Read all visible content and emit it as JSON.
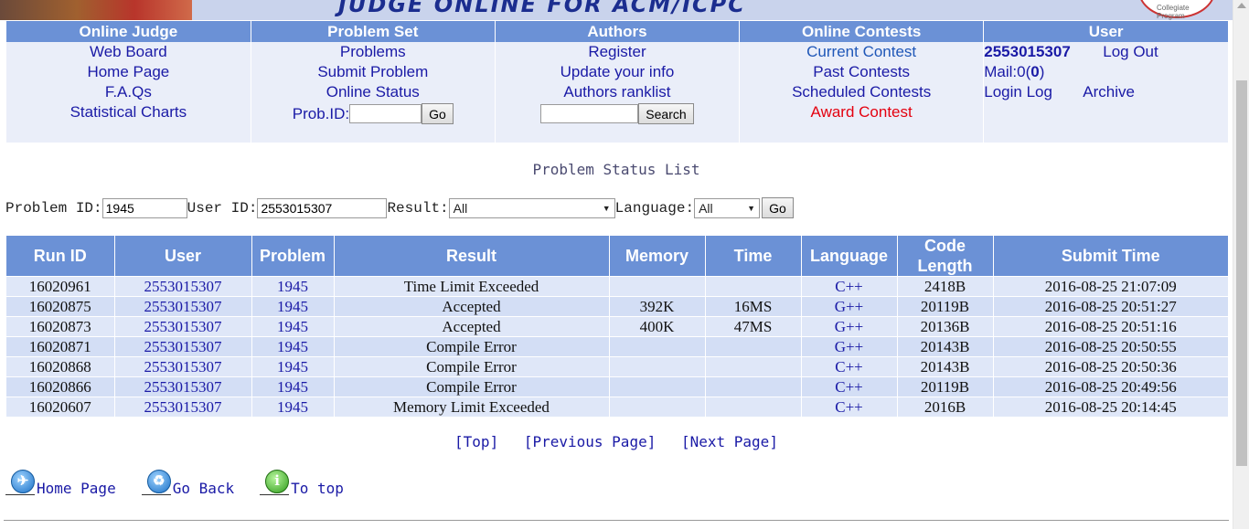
{
  "banner": {
    "title": "JUDGE ONLINE FOR ACM/ICPC",
    "logo_text": "Collegiate Program"
  },
  "nav": {
    "headers": [
      "Online Judge",
      "Problem Set",
      "Authors",
      "Online Contests",
      "User"
    ],
    "online_judge": [
      "Web Board",
      "Home Page",
      "F.A.Qs",
      "Statistical Charts"
    ],
    "problem_set": [
      "Problems",
      "Submit Problem",
      "Online Status"
    ],
    "prob_id_label": "Prob.ID:",
    "prob_id_value": "",
    "go_label": "Go",
    "authors": [
      "Register",
      "Update your info",
      "Authors ranklist"
    ],
    "author_search_value": "",
    "search_label": "Search",
    "contests": {
      "current": "Current Contest",
      "past": "Past Contests",
      "scheduled": "Scheduled Contests",
      "award": "Award Contest"
    },
    "user": {
      "id": "2553015307",
      "logout": "Log Out",
      "mail_prefix": "Mail:0(",
      "mail_count": "0",
      "mail_suffix": ")",
      "login_log": "Login Log",
      "archive": "Archive"
    }
  },
  "page_title": "Problem Status List",
  "filter": {
    "problem_label": "Problem ID:",
    "problem_value": "1945",
    "user_label": "User ID:",
    "user_value": "2553015307",
    "result_label": "Result:",
    "result_value": "All",
    "language_label": "Language:",
    "language_value": "All",
    "go_label": "Go"
  },
  "table": {
    "headers": [
      "Run ID",
      "User",
      "Problem",
      "Result",
      "Memory",
      "Time",
      "Language",
      "Code Length",
      "Submit Time"
    ],
    "rows": [
      {
        "run_id": "16020961",
        "user": "2553015307",
        "problem": "1945",
        "result": "Time Limit Exceeded",
        "result_color": "red",
        "memory": "",
        "time": "",
        "language": "C++",
        "length": "2418B",
        "submit": "2016-08-25 21:07:09"
      },
      {
        "run_id": "16020875",
        "user": "2553015307",
        "problem": "1945",
        "result": "Accepted",
        "result_color": "blue",
        "memory": "392K",
        "time": "16MS",
        "language": "G++",
        "length": "20119B",
        "submit": "2016-08-25 20:51:27"
      },
      {
        "run_id": "16020873",
        "user": "2553015307",
        "problem": "1945",
        "result": "Accepted",
        "result_color": "blue",
        "memory": "400K",
        "time": "47MS",
        "language": "G++",
        "length": "20136B",
        "submit": "2016-08-25 20:51:16"
      },
      {
        "run_id": "16020871",
        "user": "2553015307",
        "problem": "1945",
        "result": "Compile Error",
        "result_color": "green",
        "memory": "",
        "time": "",
        "language": "G++",
        "length": "20143B",
        "submit": "2016-08-25 20:50:55"
      },
      {
        "run_id": "16020868",
        "user": "2553015307",
        "problem": "1945",
        "result": "Compile Error",
        "result_color": "green",
        "memory": "",
        "time": "",
        "language": "C++",
        "length": "20143B",
        "submit": "2016-08-25 20:50:36"
      },
      {
        "run_id": "16020866",
        "user": "2553015307",
        "problem": "1945",
        "result": "Compile Error",
        "result_color": "green",
        "memory": "",
        "time": "",
        "language": "C++",
        "length": "20119B",
        "submit": "2016-08-25 20:49:56"
      },
      {
        "run_id": "16020607",
        "user": "2553015307",
        "problem": "1945",
        "result": "Memory Limit Exceeded",
        "result_color": "red",
        "memory": "",
        "time": "",
        "language": "C++",
        "length": "2016B",
        "submit": "2016-08-25 20:14:45"
      }
    ]
  },
  "pager": {
    "top": "[Top]",
    "prev": "[Previous Page]",
    "next": "[Next Page]"
  },
  "footer": {
    "home": "Home Page",
    "back": "Go Back",
    "top": "To top"
  },
  "icons": {
    "home": "airplane-icon",
    "back": "recycle-icon",
    "top": "info-icon"
  },
  "colors": {
    "header_bg": "#6b91d6",
    "link": "#1a1aa6",
    "error": "#e4000f",
    "compile": "#137a13"
  }
}
